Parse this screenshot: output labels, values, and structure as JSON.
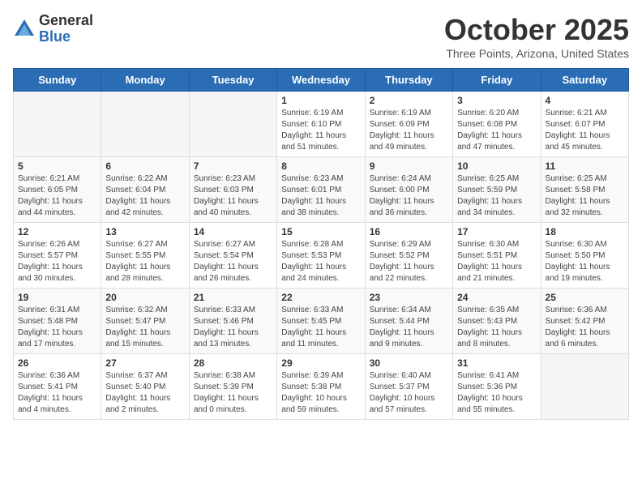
{
  "header": {
    "logo_general": "General",
    "logo_blue": "Blue",
    "month_title": "October 2025",
    "location": "Three Points, Arizona, United States"
  },
  "weekdays": [
    "Sunday",
    "Monday",
    "Tuesday",
    "Wednesday",
    "Thursday",
    "Friday",
    "Saturday"
  ],
  "weeks": [
    [
      {
        "day": "",
        "info": ""
      },
      {
        "day": "",
        "info": ""
      },
      {
        "day": "",
        "info": ""
      },
      {
        "day": "1",
        "info": "Sunrise: 6:19 AM\nSunset: 6:10 PM\nDaylight: 11 hours\nand 51 minutes."
      },
      {
        "day": "2",
        "info": "Sunrise: 6:19 AM\nSunset: 6:09 PM\nDaylight: 11 hours\nand 49 minutes."
      },
      {
        "day": "3",
        "info": "Sunrise: 6:20 AM\nSunset: 6:08 PM\nDaylight: 11 hours\nand 47 minutes."
      },
      {
        "day": "4",
        "info": "Sunrise: 6:21 AM\nSunset: 6:07 PM\nDaylight: 11 hours\nand 45 minutes."
      }
    ],
    [
      {
        "day": "5",
        "info": "Sunrise: 6:21 AM\nSunset: 6:05 PM\nDaylight: 11 hours\nand 44 minutes."
      },
      {
        "day": "6",
        "info": "Sunrise: 6:22 AM\nSunset: 6:04 PM\nDaylight: 11 hours\nand 42 minutes."
      },
      {
        "day": "7",
        "info": "Sunrise: 6:23 AM\nSunset: 6:03 PM\nDaylight: 11 hours\nand 40 minutes."
      },
      {
        "day": "8",
        "info": "Sunrise: 6:23 AM\nSunset: 6:01 PM\nDaylight: 11 hours\nand 38 minutes."
      },
      {
        "day": "9",
        "info": "Sunrise: 6:24 AM\nSunset: 6:00 PM\nDaylight: 11 hours\nand 36 minutes."
      },
      {
        "day": "10",
        "info": "Sunrise: 6:25 AM\nSunset: 5:59 PM\nDaylight: 11 hours\nand 34 minutes."
      },
      {
        "day": "11",
        "info": "Sunrise: 6:25 AM\nSunset: 5:58 PM\nDaylight: 11 hours\nand 32 minutes."
      }
    ],
    [
      {
        "day": "12",
        "info": "Sunrise: 6:26 AM\nSunset: 5:57 PM\nDaylight: 11 hours\nand 30 minutes."
      },
      {
        "day": "13",
        "info": "Sunrise: 6:27 AM\nSunset: 5:55 PM\nDaylight: 11 hours\nand 28 minutes."
      },
      {
        "day": "14",
        "info": "Sunrise: 6:27 AM\nSunset: 5:54 PM\nDaylight: 11 hours\nand 26 minutes."
      },
      {
        "day": "15",
        "info": "Sunrise: 6:28 AM\nSunset: 5:53 PM\nDaylight: 11 hours\nand 24 minutes."
      },
      {
        "day": "16",
        "info": "Sunrise: 6:29 AM\nSunset: 5:52 PM\nDaylight: 11 hours\nand 22 minutes."
      },
      {
        "day": "17",
        "info": "Sunrise: 6:30 AM\nSunset: 5:51 PM\nDaylight: 11 hours\nand 21 minutes."
      },
      {
        "day": "18",
        "info": "Sunrise: 6:30 AM\nSunset: 5:50 PM\nDaylight: 11 hours\nand 19 minutes."
      }
    ],
    [
      {
        "day": "19",
        "info": "Sunrise: 6:31 AM\nSunset: 5:48 PM\nDaylight: 11 hours\nand 17 minutes."
      },
      {
        "day": "20",
        "info": "Sunrise: 6:32 AM\nSunset: 5:47 PM\nDaylight: 11 hours\nand 15 minutes."
      },
      {
        "day": "21",
        "info": "Sunrise: 6:33 AM\nSunset: 5:46 PM\nDaylight: 11 hours\nand 13 minutes."
      },
      {
        "day": "22",
        "info": "Sunrise: 6:33 AM\nSunset: 5:45 PM\nDaylight: 11 hours\nand 11 minutes."
      },
      {
        "day": "23",
        "info": "Sunrise: 6:34 AM\nSunset: 5:44 PM\nDaylight: 11 hours\nand 9 minutes."
      },
      {
        "day": "24",
        "info": "Sunrise: 6:35 AM\nSunset: 5:43 PM\nDaylight: 11 hours\nand 8 minutes."
      },
      {
        "day": "25",
        "info": "Sunrise: 6:36 AM\nSunset: 5:42 PM\nDaylight: 11 hours\nand 6 minutes."
      }
    ],
    [
      {
        "day": "26",
        "info": "Sunrise: 6:36 AM\nSunset: 5:41 PM\nDaylight: 11 hours\nand 4 minutes."
      },
      {
        "day": "27",
        "info": "Sunrise: 6:37 AM\nSunset: 5:40 PM\nDaylight: 11 hours\nand 2 minutes."
      },
      {
        "day": "28",
        "info": "Sunrise: 6:38 AM\nSunset: 5:39 PM\nDaylight: 11 hours\nand 0 minutes."
      },
      {
        "day": "29",
        "info": "Sunrise: 6:39 AM\nSunset: 5:38 PM\nDaylight: 10 hours\nand 59 minutes."
      },
      {
        "day": "30",
        "info": "Sunrise: 6:40 AM\nSunset: 5:37 PM\nDaylight: 10 hours\nand 57 minutes."
      },
      {
        "day": "31",
        "info": "Sunrise: 6:41 AM\nSunset: 5:36 PM\nDaylight: 10 hours\nand 55 minutes."
      },
      {
        "day": "",
        "info": ""
      }
    ]
  ]
}
